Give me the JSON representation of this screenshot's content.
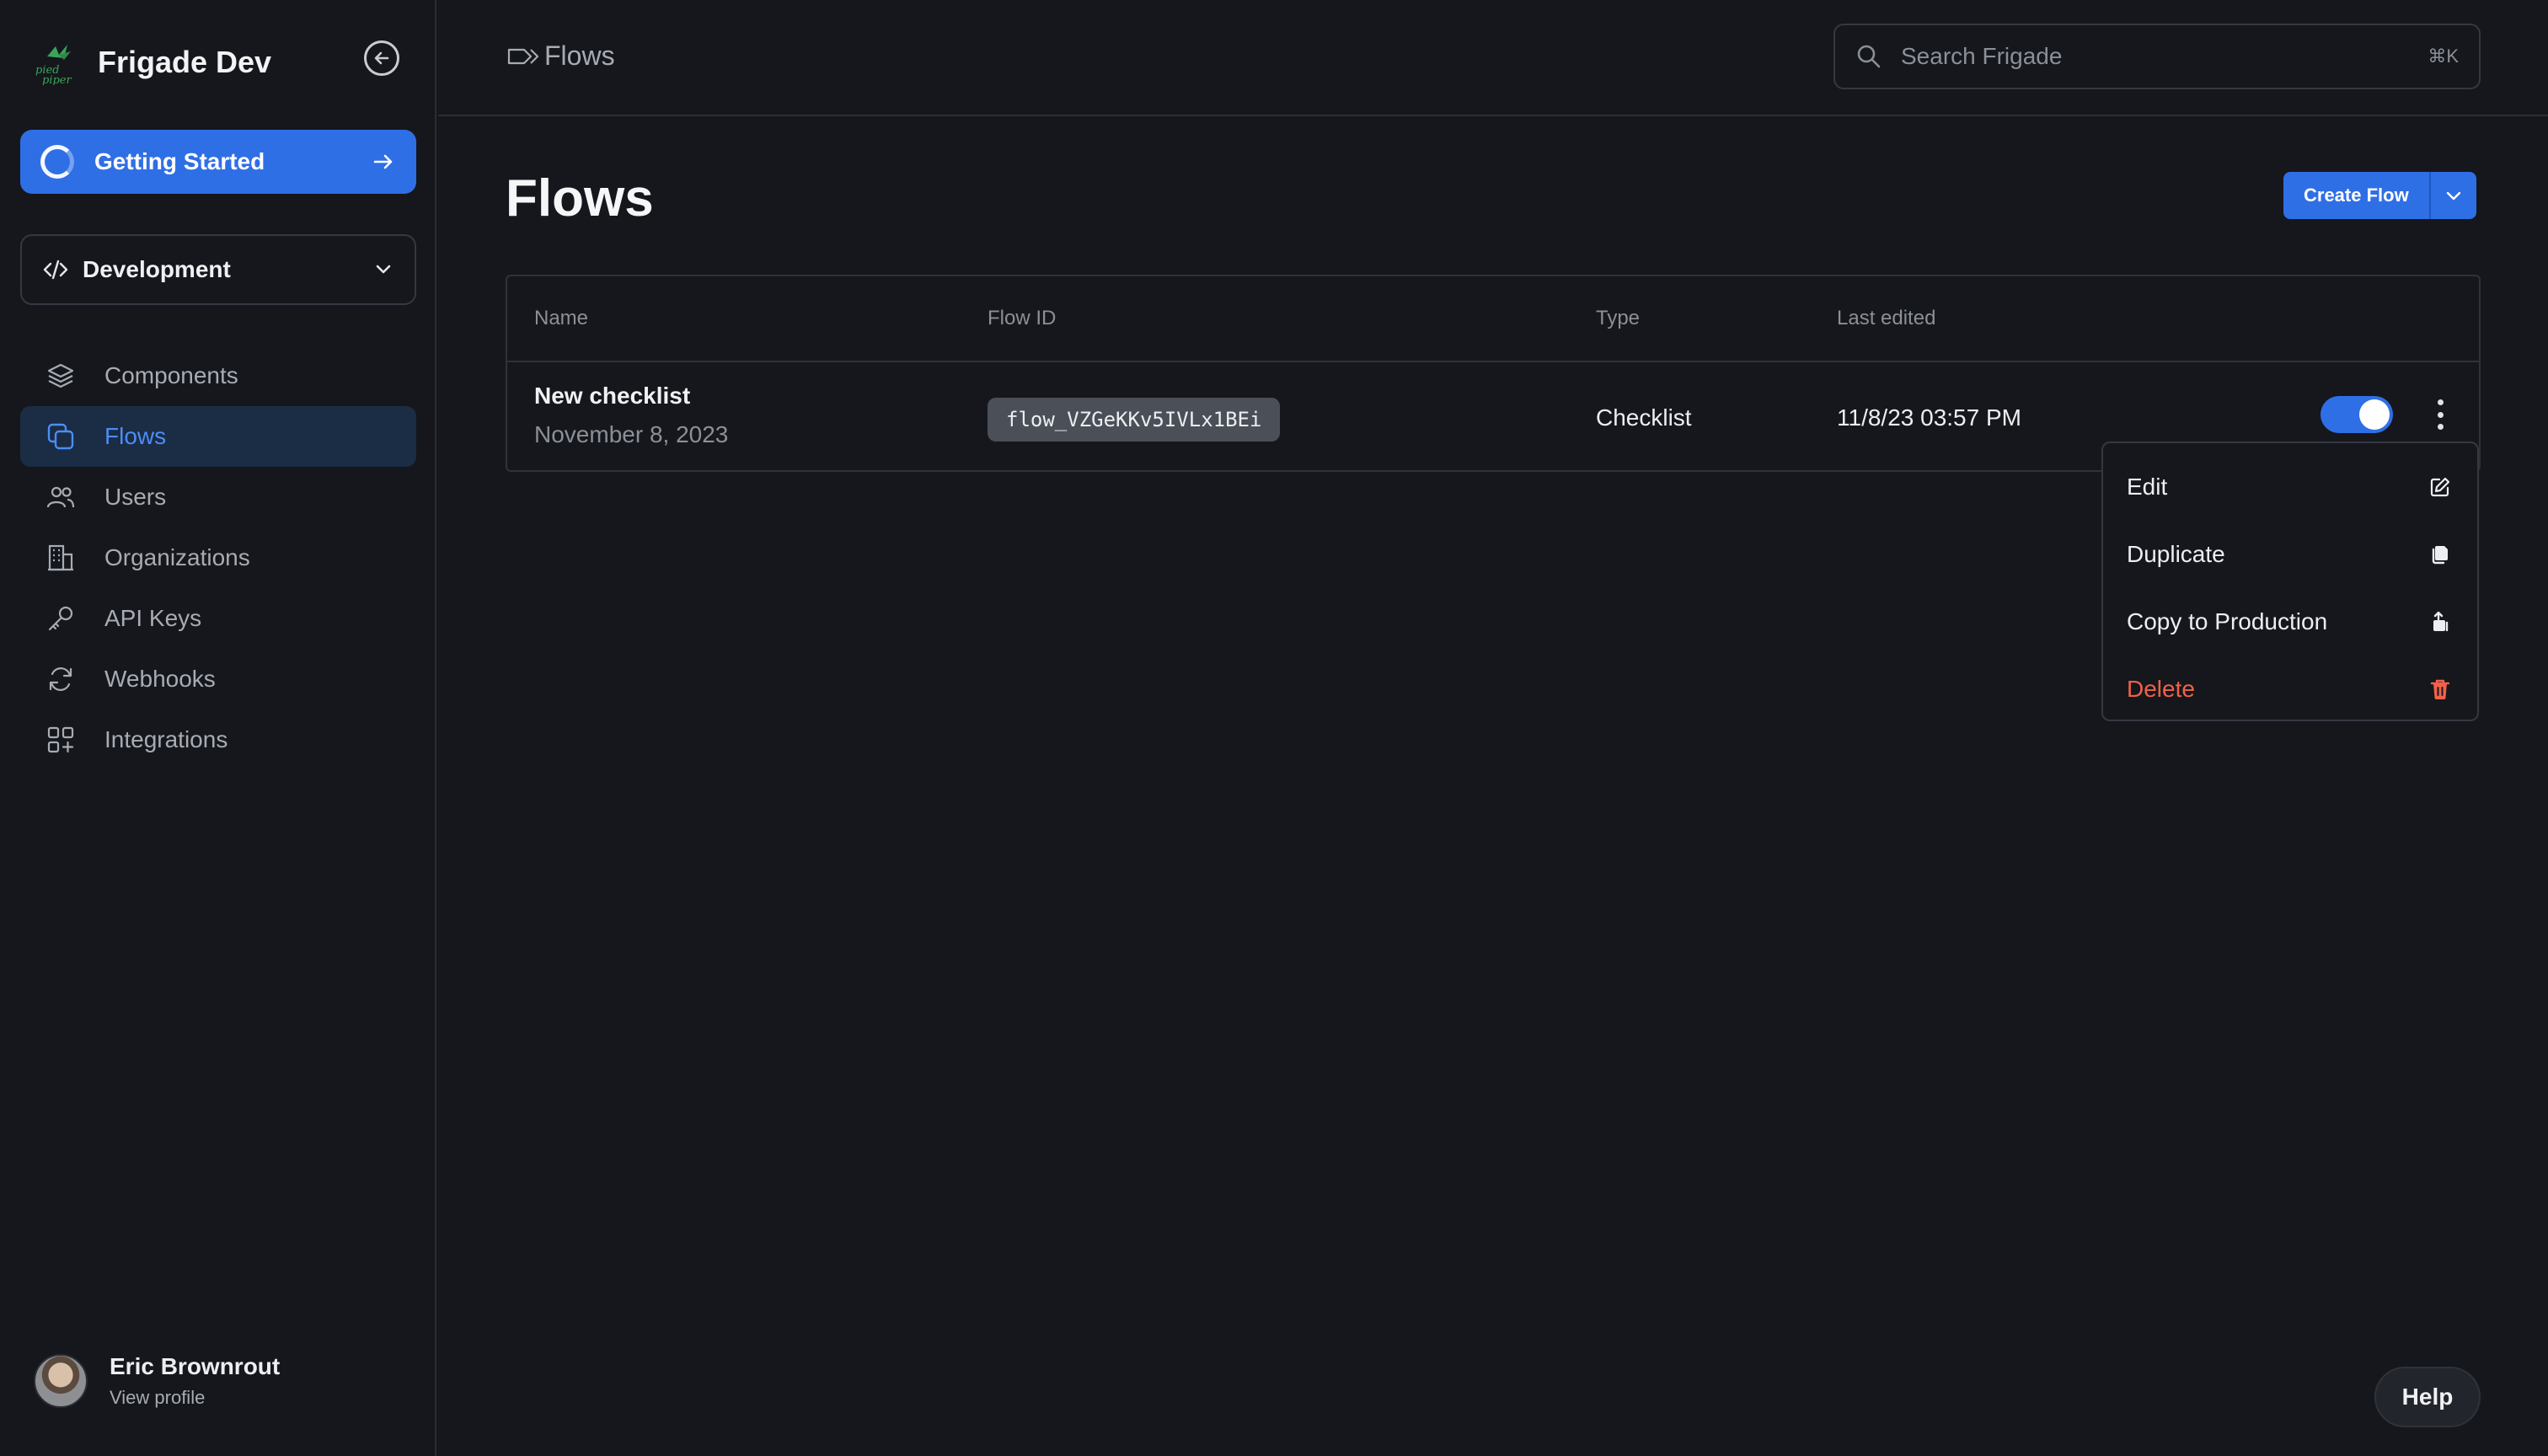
{
  "app": {
    "name": "Frigade Dev"
  },
  "sidebar": {
    "getting_started_label": "Getting Started",
    "environment": {
      "selected": "Development"
    },
    "items": [
      {
        "label": "Components",
        "icon": "layers-icon"
      },
      {
        "label": "Flows",
        "icon": "flows-icon",
        "active": true
      },
      {
        "label": "Users",
        "icon": "users-icon"
      },
      {
        "label": "Organizations",
        "icon": "building-icon"
      },
      {
        "label": "API Keys",
        "icon": "key-icon"
      },
      {
        "label": "Webhooks",
        "icon": "refresh-icon"
      },
      {
        "label": "Integrations",
        "icon": "grid-plus-icon"
      }
    ],
    "profile": {
      "name": "Eric Brownrout",
      "link": "View profile"
    }
  },
  "topbar": {
    "breadcrumb": "Flows",
    "search": {
      "placeholder": "Search Frigade",
      "shortcut": "⌘K"
    }
  },
  "main": {
    "title": "Flows",
    "create_flow_label": "Create Flow",
    "table": {
      "columns": [
        "Name",
        "Flow ID",
        "Type",
        "Last edited"
      ],
      "rows": [
        {
          "name": "New checklist",
          "created": "November 8, 2023",
          "flow_id": "flow_VZGeKKv5IVLx1BEi",
          "type": "Checklist",
          "last_edited": "11/8/23 03:57 PM",
          "enabled": true
        }
      ]
    },
    "row_menu": {
      "items": [
        {
          "label": "Edit",
          "icon": "edit-icon"
        },
        {
          "label": "Duplicate",
          "icon": "duplicate-icon"
        },
        {
          "label": "Copy to Production",
          "icon": "copy-to-production-icon"
        },
        {
          "label": "Delete",
          "icon": "trash-icon",
          "danger": true
        }
      ]
    }
  },
  "help_label": "Help",
  "colors": {
    "accent": "#2f6fe6",
    "background": "#15171c",
    "active_nav_bg": "#1b2c45",
    "danger": "#f0614a"
  }
}
